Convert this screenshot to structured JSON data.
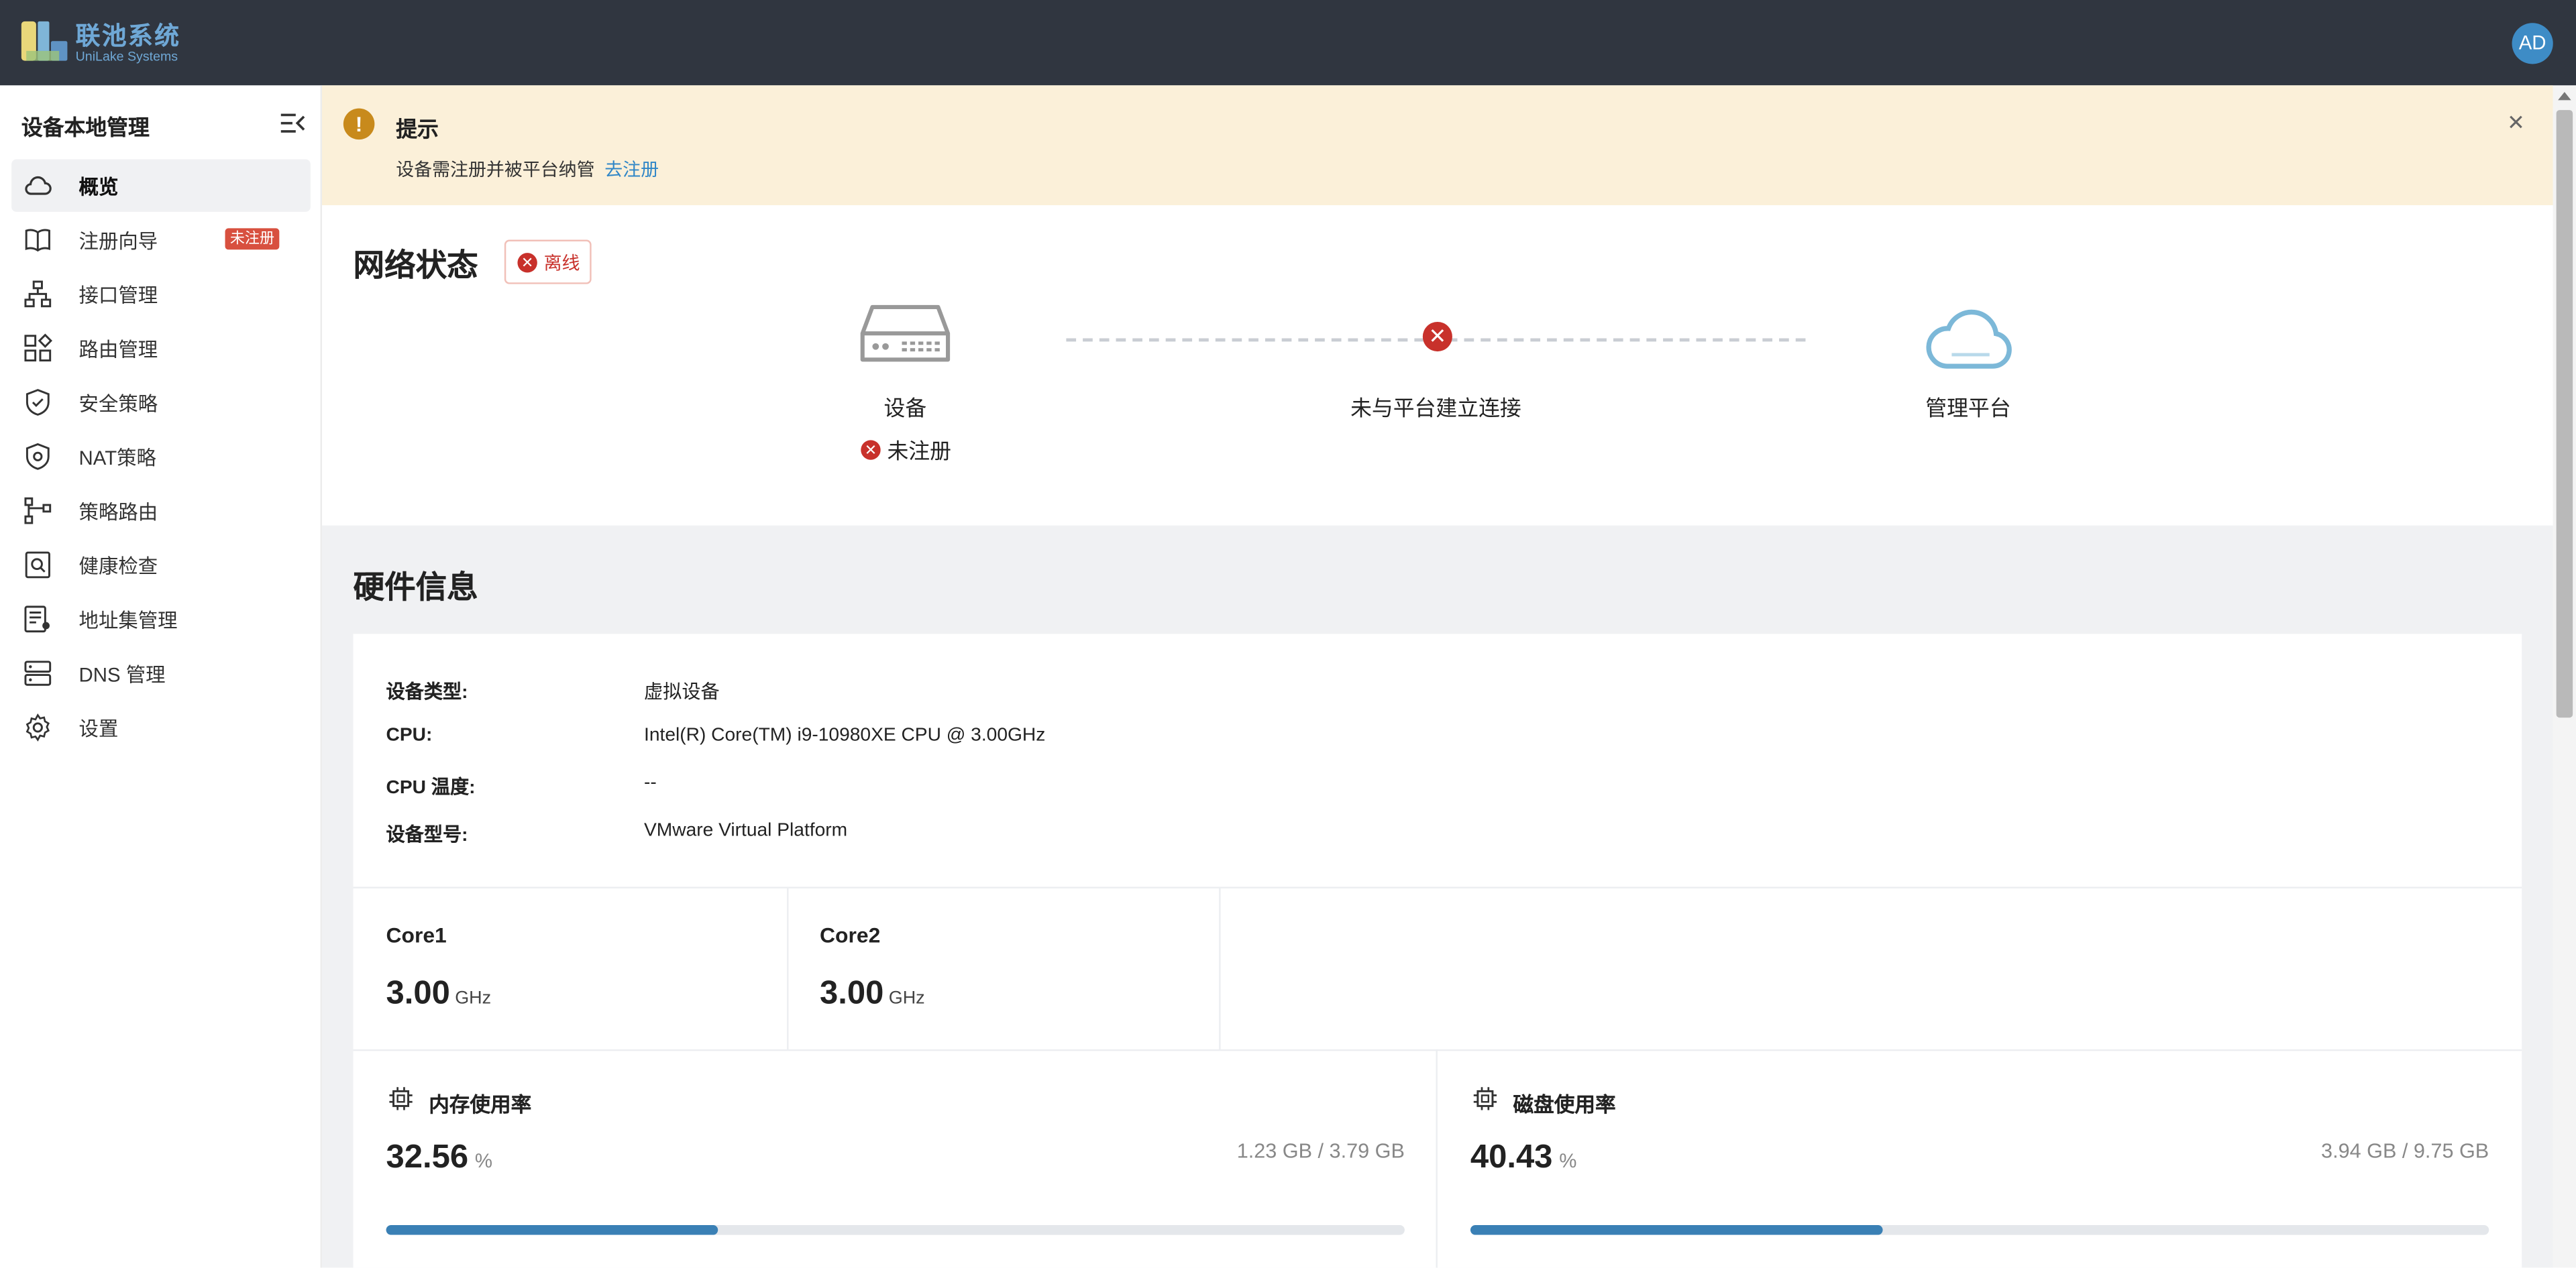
{
  "brand": {
    "name_cn": "联池系统",
    "name_en": "UniLake Systems"
  },
  "user": {
    "initials": "AD"
  },
  "sidebar": {
    "title": "设备本地管理",
    "items": [
      {
        "label": "概览",
        "icon": "cloud-icon",
        "active": true
      },
      {
        "label": "注册向导",
        "icon": "book-icon",
        "badge": "未注册"
      },
      {
        "label": "接口管理",
        "icon": "topology-icon"
      },
      {
        "label": "路由管理",
        "icon": "apps-icon"
      },
      {
        "label": "安全策略",
        "icon": "shield-check-icon"
      },
      {
        "label": "NAT策略",
        "icon": "shield-gear-icon"
      },
      {
        "label": "策略路由",
        "icon": "route-icon"
      },
      {
        "label": "健康检查",
        "icon": "search-doc-icon"
      },
      {
        "label": "地址集管理",
        "icon": "address-list-icon"
      },
      {
        "label": "DNS 管理",
        "icon": "server-icon"
      },
      {
        "label": "设置",
        "icon": "gear-icon"
      }
    ]
  },
  "notice": {
    "title": "提示",
    "message": "设备需注册并被平台纳管",
    "link": "去注册",
    "icon": "warning-icon",
    "color": "#fbf0d9"
  },
  "network": {
    "title": "网络状态",
    "status": "离线",
    "device_label": "设备",
    "device_status": "未注册",
    "link_status": "未与平台建立连接",
    "platform_label": "管理平台",
    "error_color": "#c8312b"
  },
  "hardware": {
    "title": "硬件信息",
    "info": [
      {
        "key": "设备类型:",
        "value": "虚拟设备"
      },
      {
        "key": "CPU:",
        "value": "Intel(R) Core(TM) i9-10980XE CPU @ 3.00GHz"
      },
      {
        "key": "CPU 温度:",
        "value": "--"
      },
      {
        "key": "设备型号:",
        "value": "VMware Virtual Platform"
      }
    ],
    "cores": [
      {
        "name": "Core1",
        "value": "3.00",
        "unit": "GHz"
      },
      {
        "name": "Core2",
        "value": "3.00",
        "unit": "GHz"
      }
    ],
    "memory": {
      "title": "内存使用率",
      "percent": "32.56",
      "unit": "%",
      "amount": "1.23 GB / 3.79 GB",
      "fraction": 0.3256
    },
    "disk": {
      "title": "磁盘使用率",
      "percent": "40.43",
      "unit": "%",
      "amount": "3.94 GB / 9.75 GB",
      "fraction": 0.4043
    },
    "bar_color": "#3a80b5"
  }
}
